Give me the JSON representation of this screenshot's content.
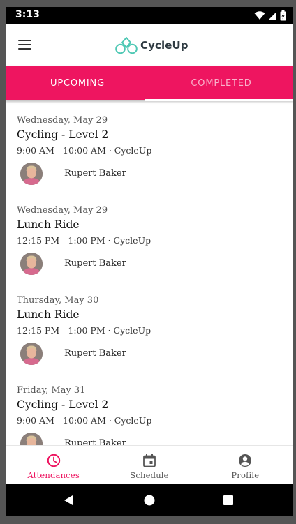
{
  "status_bar": {
    "time": "3:13"
  },
  "app_bar": {
    "brand_name": "CycleUp",
    "icons": {
      "menu": "hamburger-menu-icon",
      "logo": "bicycle-logo-icon"
    }
  },
  "colors": {
    "accent": "#ee1560",
    "logo_teal": "#4ec8b4",
    "inactive_tab_text": "#f9b3cb"
  },
  "tabs": [
    {
      "label": "UPCOMING",
      "active": true
    },
    {
      "label": "COMPLETED",
      "active": false
    }
  ],
  "classes": [
    {
      "date": "Wednesday, May 29",
      "title": "Cycling - Level 2",
      "time": "9:00 AM - 10:00 AM · CycleUp",
      "instructor": "Rupert Baker"
    },
    {
      "date": "Wednesday, May 29",
      "title": "Lunch Ride",
      "time": "12:15 PM - 1:00 PM · CycleUp",
      "instructor": "Rupert Baker"
    },
    {
      "date": "Thursday, May 30",
      "title": "Lunch Ride",
      "time": "12:15 PM - 1:00 PM · CycleUp",
      "instructor": "Rupert Baker"
    },
    {
      "date": "Friday, May 31",
      "title": "Cycling - Level 2",
      "time": "9:00 AM - 10:00 AM · CycleUp",
      "instructor": "Rupert Baker"
    }
  ],
  "bottom_nav": [
    {
      "label": "Attendances",
      "icon": "clock-icon",
      "active": true
    },
    {
      "label": "Schedule",
      "icon": "calendar-icon",
      "active": false
    },
    {
      "label": "Profile",
      "icon": "account-circle-icon",
      "active": false
    }
  ],
  "system_nav": {
    "icons": [
      "back-icon",
      "home-icon",
      "recents-icon"
    ]
  }
}
